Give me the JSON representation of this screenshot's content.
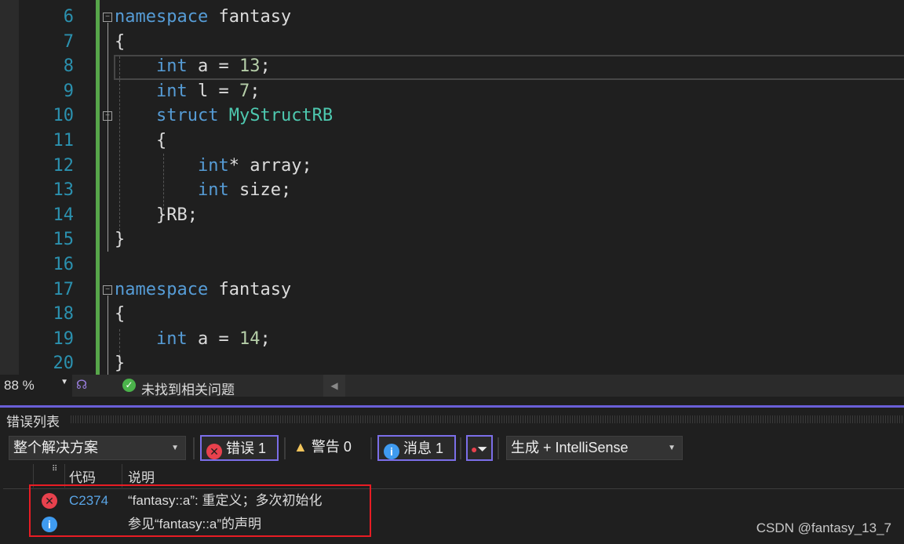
{
  "editor": {
    "lines": [
      {
        "n": "6",
        "tokens": [
          [
            "kw",
            "namespace"
          ],
          [
            "pl",
            " fantasy"
          ]
        ]
      },
      {
        "n": "7",
        "tokens": [
          [
            "pl",
            "{"
          ]
        ]
      },
      {
        "n": "8",
        "tokens": [
          [
            "pl",
            "    "
          ],
          [
            "kw",
            "int"
          ],
          [
            "pl",
            " a = "
          ],
          [
            "num",
            "13"
          ],
          [
            "pl",
            ";"
          ]
        ]
      },
      {
        "n": "9",
        "tokens": [
          [
            "pl",
            "    "
          ],
          [
            "kw",
            "int"
          ],
          [
            "pl",
            " l = "
          ],
          [
            "num",
            "7"
          ],
          [
            "pl",
            ";"
          ]
        ]
      },
      {
        "n": "10",
        "tokens": [
          [
            "pl",
            "    "
          ],
          [
            "kw",
            "struct"
          ],
          [
            "pl",
            " "
          ],
          [
            "ty",
            "MyStructRB"
          ]
        ]
      },
      {
        "n": "11",
        "tokens": [
          [
            "pl",
            "    {"
          ]
        ]
      },
      {
        "n": "12",
        "tokens": [
          [
            "pl",
            "        "
          ],
          [
            "kw",
            "int"
          ],
          [
            "pl",
            "* array;"
          ]
        ]
      },
      {
        "n": "13",
        "tokens": [
          [
            "pl",
            "        "
          ],
          [
            "kw",
            "int"
          ],
          [
            "pl",
            " size;"
          ]
        ]
      },
      {
        "n": "14",
        "tokens": [
          [
            "pl",
            "    }RB;"
          ]
        ]
      },
      {
        "n": "15",
        "tokens": [
          [
            "pl",
            "}"
          ]
        ]
      },
      {
        "n": "16",
        "tokens": []
      },
      {
        "n": "17",
        "tokens": [
          [
            "kw",
            "namespace"
          ],
          [
            "pl",
            " fantasy"
          ]
        ]
      },
      {
        "n": "18",
        "tokens": [
          [
            "pl",
            "{"
          ]
        ]
      },
      {
        "n": "19",
        "tokens": [
          [
            "pl",
            "    "
          ],
          [
            "kw",
            "int"
          ],
          [
            "pl",
            " a = "
          ],
          [
            "num",
            "14"
          ],
          [
            "pl",
            ";"
          ]
        ]
      },
      {
        "n": "20",
        "tokens": [
          [
            "pl",
            "}"
          ]
        ]
      }
    ]
  },
  "status": {
    "zoom": "88 %",
    "issues": "未找到相关问题"
  },
  "error_list": {
    "title": "错误列表",
    "scope": "整个解决方案",
    "errors_label": "错误 1",
    "warnings_label": "警告 0",
    "messages_label": "消息 1",
    "source": "生成 + IntelliSense",
    "columns": {
      "code": "代码",
      "description": "说明"
    },
    "rows": [
      {
        "icon": "error-icon",
        "code": "C2374",
        "description": "“fantasy::a”: 重定义；多次初始化"
      },
      {
        "icon": "info-icon",
        "code": "",
        "description": "参见“fantasy::a”的声明"
      }
    ]
  },
  "watermark": "CSDN @fantasy_13_7",
  "colors": {
    "accent": "#6a5fd8",
    "error": "#e8414d",
    "info": "#3f9bf0",
    "highlight": "#e81c24"
  }
}
